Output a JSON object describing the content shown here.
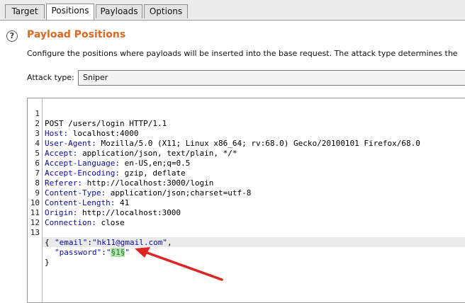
{
  "tabs": [
    {
      "label": "Target",
      "active": false
    },
    {
      "label": "Positions",
      "active": true
    },
    {
      "label": "Payloads",
      "active": false
    },
    {
      "label": "Options",
      "active": false
    }
  ],
  "section": {
    "help_icon": "?",
    "title": "Payload Positions",
    "description": "Configure the positions where payloads will be inserted into the base request. The attack type determines the"
  },
  "attack_type": {
    "label": "Attack type:",
    "value": "Sniper"
  },
  "request": {
    "line_numbers": [
      "1",
      "2",
      "3",
      "4",
      "5",
      "6",
      "7",
      "8",
      "9",
      "10",
      "11",
      "12",
      "13",
      "",
      "",
      ""
    ],
    "lines": [
      {
        "plain": "POST /users/login HTTP/1.1"
      },
      {
        "key": "Host:",
        "val": " localhost:4000"
      },
      {
        "key": "User-Agent:",
        "val": " Mozilla/5.0 (X11; Linux x86_64; rv:68.0) Gecko/20100101 Firefox/68.0"
      },
      {
        "key": "Accept:",
        "val": " application/json, text/plain, */*"
      },
      {
        "key": "Accept-Language:",
        "val": " en-US,en;q=0.5"
      },
      {
        "key": "Accept-Encoding:",
        "val": " gzip, deflate"
      },
      {
        "key": "Referer:",
        "val": " http://localhost:3000/login"
      },
      {
        "key": "Content-Type:",
        "val": " application/json;charset=utf-8"
      },
      {
        "key": "Content-Length:",
        "val": " 41"
      },
      {
        "key": "Origin:",
        "val": " http://localhost:3000"
      },
      {
        "key": "Connection:",
        "val": " close"
      },
      {
        "plain": ""
      },
      {
        "plain": "{"
      }
    ],
    "body": {
      "email_key": "\"email\"",
      "email_sep": ":",
      "email_val": "\"hk11@gmail.com\"",
      "email_end": ",",
      "pw_key": "\"password\"",
      "pw_sep": ":",
      "pw_q1": "\"",
      "pw_marker": "§1§",
      "pw_q2": "\"",
      "close": "}"
    }
  },
  "colors": {
    "accent_title": "#e0671f",
    "header_key": "#0b0bb0",
    "payload_marker_bg": "#b5e3b5",
    "arrow": "#e02424"
  }
}
